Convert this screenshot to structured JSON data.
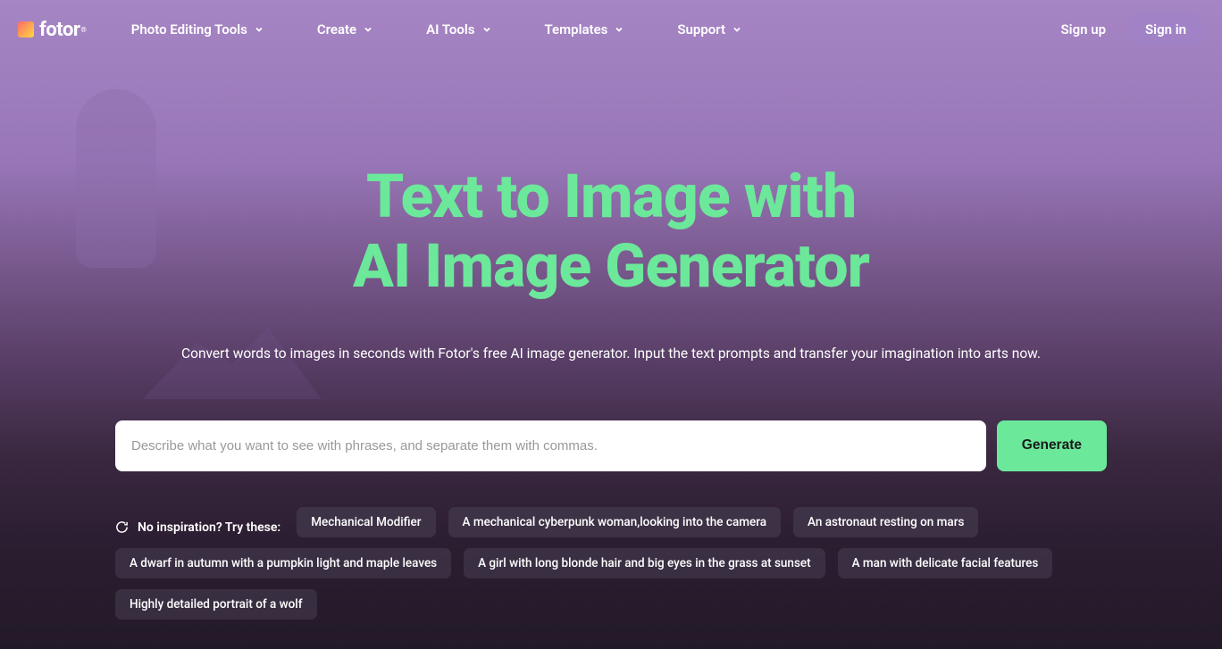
{
  "brand": {
    "name": "fotor"
  },
  "nav": {
    "items": [
      {
        "label": "Photo Editing Tools"
      },
      {
        "label": "Create"
      },
      {
        "label": "AI Tools"
      },
      {
        "label": "Templates"
      },
      {
        "label": "Support"
      }
    ]
  },
  "auth": {
    "signup": "Sign up",
    "signin": "Sign in"
  },
  "hero": {
    "title_line1": "Text to Image with",
    "title_line2": "AI Image Generator",
    "subtitle": "Convert words to images in seconds with Fotor's free AI image generator. Input the text prompts and transfer your imagination into arts now."
  },
  "input": {
    "placeholder": "Describe what you want to see with phrases, and separate them with commas.",
    "generate_label": "Generate"
  },
  "suggestions": {
    "header": "No inspiration? Try these:",
    "chips": [
      "Mechanical Modifier",
      "A mechanical cyberpunk woman,looking into the camera",
      "An astronaut resting on mars",
      "A dwarf in autumn with a pumpkin light and maple leaves",
      "A girl with long blonde hair and big eyes in the grass at sunset",
      "A man with delicate facial features",
      "Highly detailed portrait of a wolf"
    ]
  }
}
